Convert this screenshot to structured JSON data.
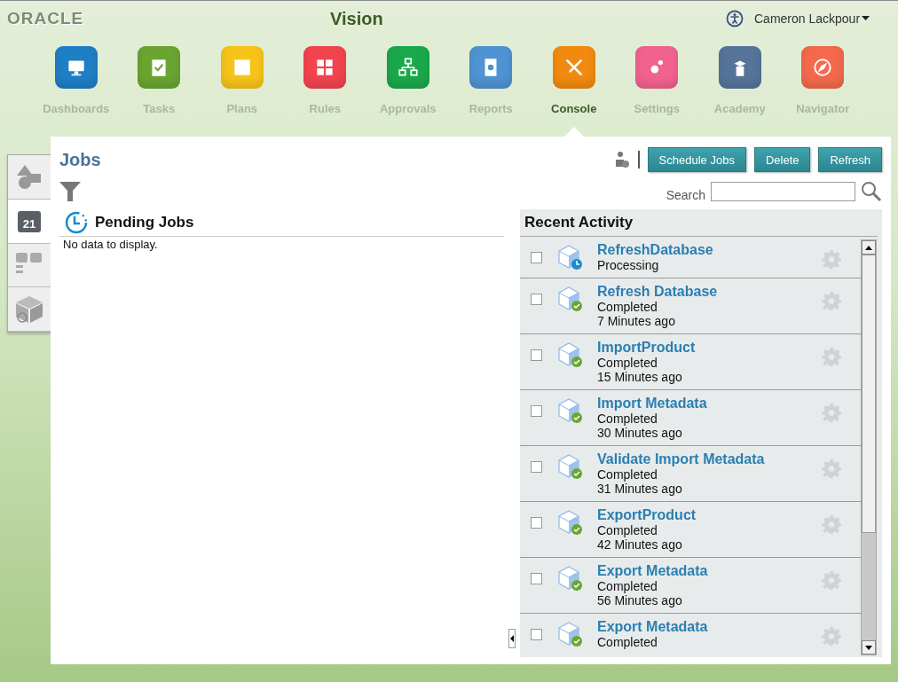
{
  "header": {
    "logo": "ORACLE",
    "app_title": "Vision",
    "user": "Cameron Lackpour"
  },
  "nav": [
    {
      "label": "Dashboards",
      "color": "#1f7fc4",
      "selected": false
    },
    {
      "label": "Tasks",
      "color": "#6aa531",
      "selected": false
    },
    {
      "label": "Plans",
      "color": "#f6c419",
      "selected": false
    },
    {
      "label": "Rules",
      "color": "#f2444f",
      "selected": false
    },
    {
      "label": "Approvals",
      "color": "#1aa84a",
      "selected": false
    },
    {
      "label": "Reports",
      "color": "#4f93d2",
      "selected": false
    },
    {
      "label": "Console",
      "color": "#f28a0f",
      "selected": true
    },
    {
      "label": "Settings",
      "color": "#f2628f",
      "selected": false
    },
    {
      "label": "Academy",
      "color": "#56749a",
      "selected": false
    },
    {
      "label": "Navigator",
      "color": "#f4694c",
      "selected": false
    }
  ],
  "side_tabs": [
    {
      "selected": false
    },
    {
      "selected": true,
      "label": "21"
    },
    {
      "selected": false
    },
    {
      "selected": false
    }
  ],
  "page": {
    "title": "Jobs",
    "buttons": [
      "Schedule Jobs",
      "Delete",
      "Refresh"
    ],
    "search": {
      "label": "Search"
    }
  },
  "pending": {
    "title": "Pending Jobs",
    "empty": "No data to display."
  },
  "recent": {
    "title": "Recent Activity",
    "rows": [
      {
        "name": "RefreshDatabase",
        "status": "Processing",
        "kind": "processing",
        "checked": false
      },
      {
        "name": "Refresh Database",
        "status": "Completed",
        "time": "7 Minutes ago",
        "kind": "completed",
        "checked": false
      },
      {
        "name": "ImportProduct",
        "status": "Completed",
        "time": "15 Minutes ago",
        "kind": "completed",
        "checked": false
      },
      {
        "name": "Import Metadata",
        "status": "Completed",
        "time": "30 Minutes ago",
        "kind": "completed",
        "checked": false
      },
      {
        "name": "Validate Import Metadata",
        "status": "Completed",
        "time": "31 Minutes ago",
        "kind": "completed",
        "checked": false
      },
      {
        "name": "ExportProduct",
        "status": "Completed",
        "time": "42 Minutes ago",
        "kind": "completed",
        "checked": false
      },
      {
        "name": "Export Metadata",
        "status": "Completed",
        "time": "56 Minutes ago",
        "kind": "completed",
        "checked": false
      },
      {
        "name": "Export Metadata",
        "status": "Completed",
        "kind": "completed",
        "checked": false
      }
    ]
  }
}
